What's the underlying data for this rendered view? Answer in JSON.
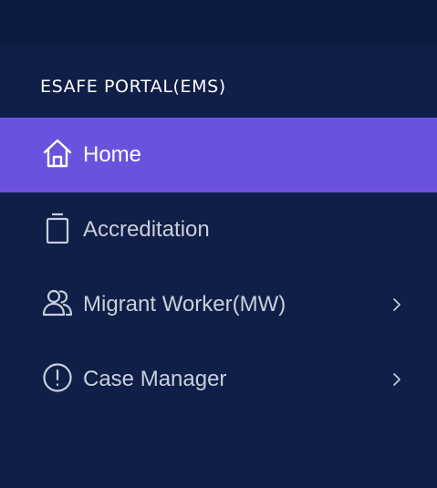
{
  "sidebar": {
    "brand": "ESAFE PORTAL(EMS)",
    "items": [
      {
        "label": "Home",
        "icon": "home-icon",
        "active": true,
        "has_submenu": false
      },
      {
        "label": "Accreditation",
        "icon": "clipboard-icon",
        "active": false,
        "has_submenu": false
      },
      {
        "label": "Migrant Worker(MW)",
        "icon": "users-icon",
        "active": false,
        "has_submenu": true
      },
      {
        "label": "Case Manager",
        "icon": "alert-circle-icon",
        "active": false,
        "has_submenu": true
      }
    ]
  },
  "colors": {
    "background": "#0f1f47",
    "active_item": "#6b52de",
    "text": "#c9cfdb",
    "active_text": "#ffffff"
  }
}
